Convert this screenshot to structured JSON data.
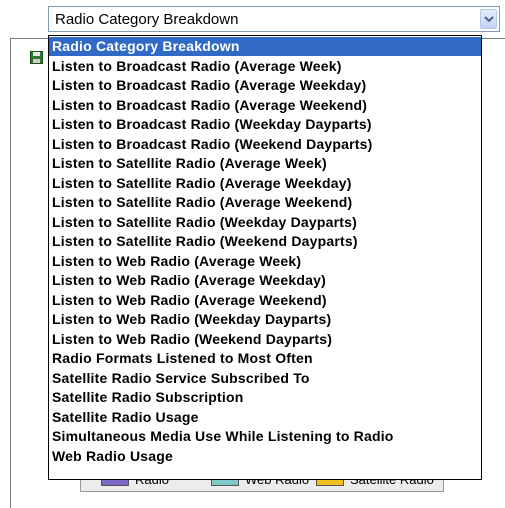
{
  "select": {
    "value": "Radio Category Breakdown"
  },
  "options": [
    "Radio Category Breakdown",
    "Listen to Broadcast Radio (Average Week)",
    "Listen to Broadcast Radio (Average Weekday)",
    "Listen to Broadcast Radio (Average Weekend)",
    "Listen to Broadcast Radio (Weekday Dayparts)",
    "Listen to Broadcast Radio (Weekend Dayparts)",
    "Listen to Satellite Radio (Average Week)",
    "Listen to Satellite Radio (Average Weekday)",
    "Listen to Satellite Radio (Average Weekend)",
    "Listen to Satellite Radio (Weekday Dayparts)",
    "Listen to Satellite Radio (Weekend Dayparts)",
    "Listen to Web Radio (Average Week)",
    "Listen to Web Radio (Average Weekday)",
    "Listen to Web Radio (Average Weekend)",
    "Listen to Web Radio (Weekday Dayparts)",
    "Listen to Web Radio (Weekend Dayparts)",
    "Radio Formats Listened to Most Often",
    "Satellite Radio Service Subscribed To",
    "Satellite Radio Subscription",
    "Satellite Radio Usage",
    "Simultaneous Media Use While Listening to Radio",
    "Web Radio Usage"
  ],
  "selected_index": 0,
  "legend": {
    "items": [
      {
        "label": "Radio",
        "color": "#7b68c8"
      },
      {
        "label": "Web Radio",
        "color": "#7fc9c9"
      },
      {
        "label": "Satellite Radio",
        "color": "#f0c020"
      }
    ]
  },
  "colors": {
    "selected_bg": "#3169c6",
    "selected_fg": "#ffffff",
    "select_border": "#7f9db9"
  },
  "icons": {
    "select_button": "chevron-down-icon",
    "save": "save-icon"
  }
}
